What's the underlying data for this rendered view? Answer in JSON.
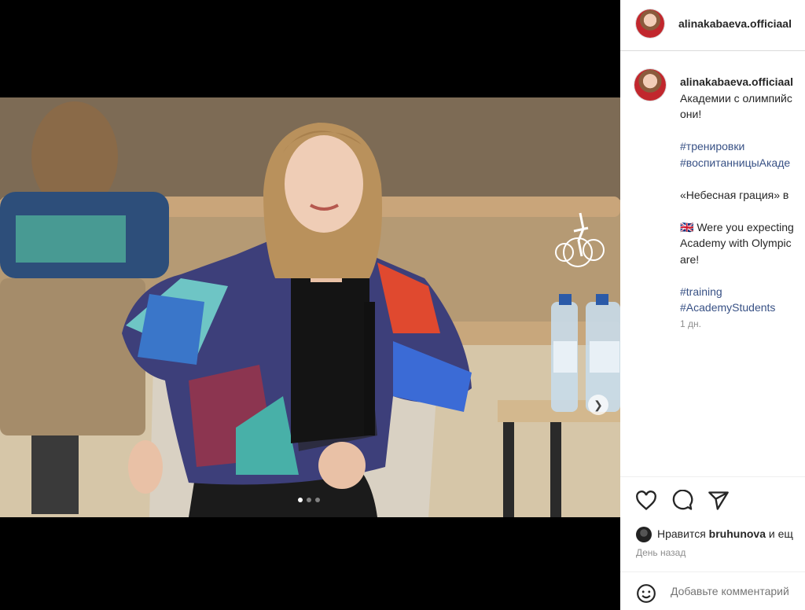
{
  "post": {
    "username": "alinakabaeva.officiaal",
    "caption_lines": [
      "Академии с олимпийс",
      "они!"
    ],
    "hashtags_ru": [
      "#тренировки",
      "#воспитанницыАкаде"
    ],
    "quote_line": "«Небесная грация» в",
    "en_lines": [
      "🇬🇧 Were you expecting",
      "Academy with Olympic",
      "are!"
    ],
    "hashtags_en": [
      "#training",
      "#AcademyStudents"
    ],
    "caption_time": "1 дн.",
    "likes_prefix": "Нравится",
    "likes_user": "bruhunova",
    "likes_suffix": "и ещ",
    "posted_ago": "День назад",
    "comment_placeholder": "Добавьте комментарий"
  },
  "carousel": {
    "current": 1,
    "total": 3
  },
  "icons": {
    "like": "heart-icon",
    "comment": "comment-icon",
    "share": "share-icon",
    "emoji": "emoji-icon",
    "next": "chevron-right-icon"
  },
  "colors": {
    "hashtag": "#385185",
    "muted": "#8e8e8e"
  }
}
